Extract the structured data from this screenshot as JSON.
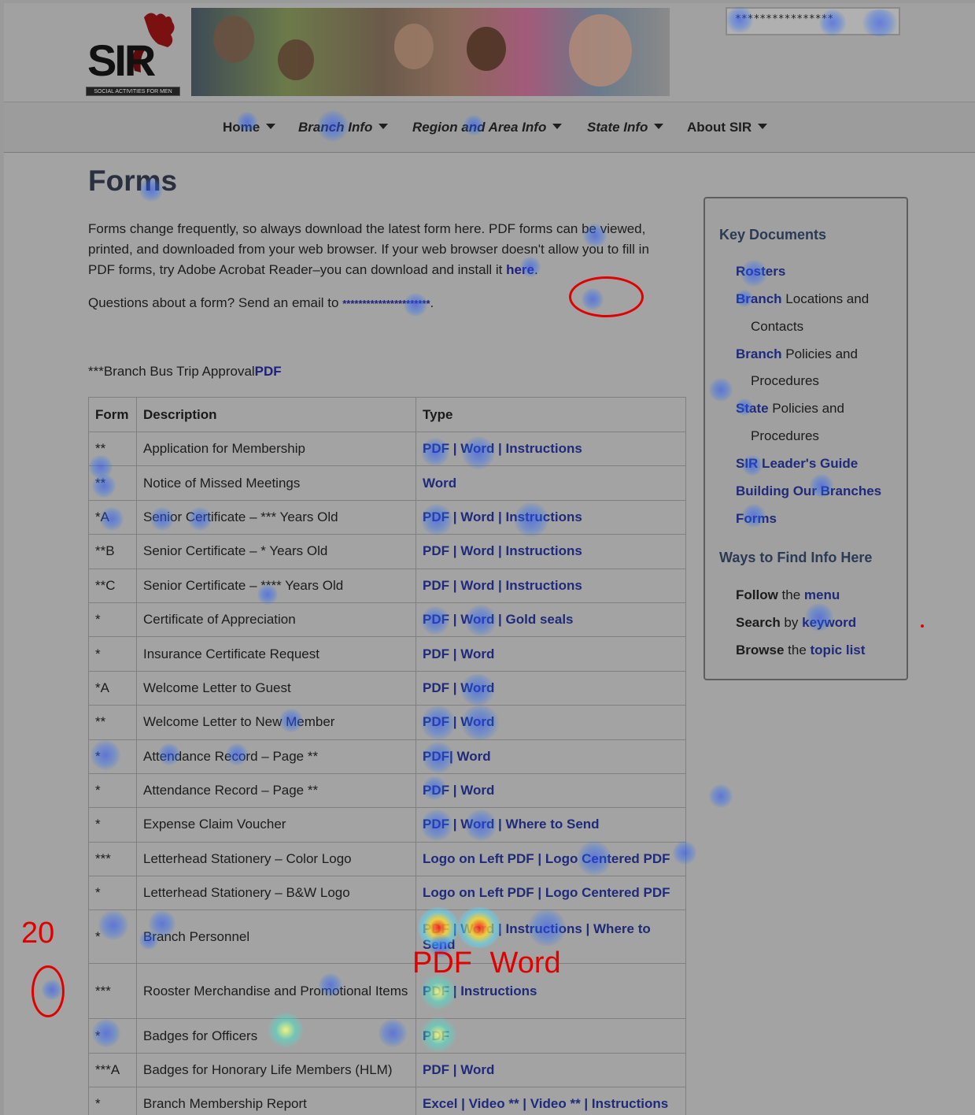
{
  "header": {
    "logo_text": "SIR",
    "logo_tagline": "SOCIAL ACTIVITIES FOR MEN",
    "search_value": "****************"
  },
  "nav": {
    "items": [
      {
        "label": "Home"
      },
      {
        "label": "Branch Info"
      },
      {
        "label": "Region and Area Info"
      },
      {
        "label": "State Info"
      },
      {
        "label": "About SIR"
      }
    ]
  },
  "main": {
    "title": "Forms",
    "intro_text": "Forms change frequently, so always download the latest form here. PDF forms can be viewed, printed, and downloaded from your web browser. If your web browser doesn't allow you to fill in PDF forms, try Adobe Acrobat Reader–you can download and install it ",
    "intro_link": "here",
    "questions_text": "Questions about a form? Send an email to ",
    "questions_email": "**********************",
    "bus_trip_text": "***Branch Bus Trip Approval",
    "bus_trip_link": "PDF"
  },
  "table": {
    "headers": [
      "Form",
      "Description",
      "Type"
    ],
    "rows": [
      {
        "form": "**",
        "description": "Application for Membership",
        "type": "PDF | Word | Instructions"
      },
      {
        "form": "**",
        "description": "Notice of Missed Meetings",
        "type": "Word"
      },
      {
        "form": "*A",
        "description": "Senior Certificate – *** Years Old",
        "type": "PDF | Word | Instructions"
      },
      {
        "form": "**B",
        "description": "Senior Certificate – * Years Old",
        "type": "PDF | Word | Instructions"
      },
      {
        "form": "**C",
        "description": "Senior Certificate – **** Years Old",
        "type": "PDF | Word | Instructions"
      },
      {
        "form": "*",
        "description": "Certificate of Appreciation",
        "type": "PDF | Word | Gold seals"
      },
      {
        "form": "*",
        "description": "Insurance Certificate Request",
        "type": "PDF | Word"
      },
      {
        "form": "*A",
        "description": "Welcome Letter to Guest",
        "type": "PDF | Word"
      },
      {
        "form": "**",
        "description": "Welcome Letter to New Member",
        "type": "PDF | Word"
      },
      {
        "form": "*",
        "description": "Attendance Record – Page **",
        "type": "PDF| Word"
      },
      {
        "form": "*",
        "description": "Attendance Record – Page **",
        "type": "PDF | Word"
      },
      {
        "form": "*",
        "description": "Expense Claim Voucher",
        "type": "PDF | Word | Where to Send"
      },
      {
        "form": "***",
        "description": "Letterhead Stationery – Color Logo",
        "type": "Logo on Left PDF | Logo Centered PDF"
      },
      {
        "form": "*",
        "description": "Letterhead Stationery – B&W Logo",
        "type": "Logo on Left PDF | Logo Centered PDF"
      },
      {
        "form": "*",
        "description": "Branch Personnel",
        "type": "PDF | Word | Instructions | Where to Send"
      },
      {
        "form": "***",
        "description": "Rooster Merchandise and Promotional Items",
        "type": "PDF | Instructions"
      },
      {
        "form": "*",
        "description": "Badges for Officers",
        "type": "PDF"
      },
      {
        "form": "***A",
        "description": "Badges for Honorary Life Members (HLM)",
        "type": "PDF | Word"
      },
      {
        "form": "*",
        "description": "Branch Membership Report",
        "type": "Excel | Video ** | Video ** | Instructions"
      }
    ]
  },
  "sidebar": {
    "key_docs_title": "Key Documents",
    "rosters": "Rosters",
    "branch_locations_link": "Branch",
    "branch_locations_rest": " Locations and",
    "branch_locations_cont": "Contacts",
    "branch_policies_link": "Branch",
    "branch_policies_rest": " Policies and",
    "branch_policies_cont": "Procedures",
    "state_policies_link": "State",
    "state_policies_rest": " Policies and",
    "state_policies_cont": "Procedures",
    "leaders_guide": "SIR Leader's Guide",
    "building": "Building Our Branches",
    "forms": "Forms",
    "ways_title": "Ways to Find Info Here",
    "follow_bold": "Follow",
    "follow_mid": " the ",
    "follow_link": "menu",
    "search_bold": "Search",
    "search_mid": " by ",
    "search_link": "keyword",
    "browse_bold": "Browse",
    "browse_mid": " the ",
    "browse_link": "topic list"
  },
  "annotations": {
    "count_label": "20",
    "handwritten_words": "PDF Word"
  },
  "colors": {
    "annotation_red": "#e10000",
    "link_blue": "#1f2a7a",
    "heat_blue": "#2850ff"
  }
}
